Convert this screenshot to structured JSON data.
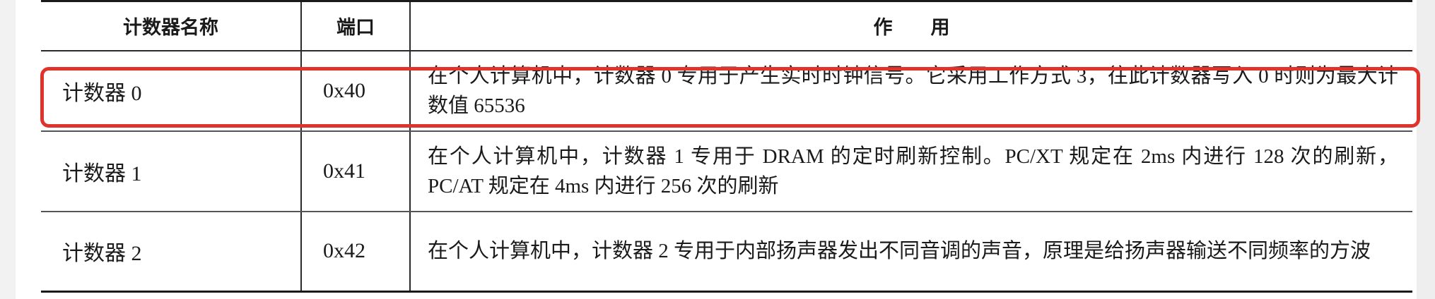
{
  "table": {
    "headers": {
      "name": "计数器名称",
      "port": "端口",
      "desc": "作　　用"
    },
    "rows": [
      {
        "name": "计数器 0",
        "port": "0x40",
        "desc": "在个人计算机中，计数器 0 专用于产生实时时钟信号。它采用工作方式 3，往此计数器写入 0 时则为最大计数值 65536"
      },
      {
        "name": "计数器 1",
        "port": "0x41",
        "desc": "在个人计算机中，计数器 1 专用于 DRAM 的定时刷新控制。PC/XT 规定在 2ms 内进行 128 次的刷新，PC/AT 规定在 4ms 内进行 256 次的刷新"
      },
      {
        "name": "计数器 2",
        "port": "0x42",
        "desc": "在个人计算机中，计数器 2 专用于内部扬声器发出不同音调的声音，原理是给扬声器输送不同频率的方波"
      }
    ]
  },
  "highlight": {
    "color": "#e0332b",
    "target_row": "计数器 0"
  }
}
